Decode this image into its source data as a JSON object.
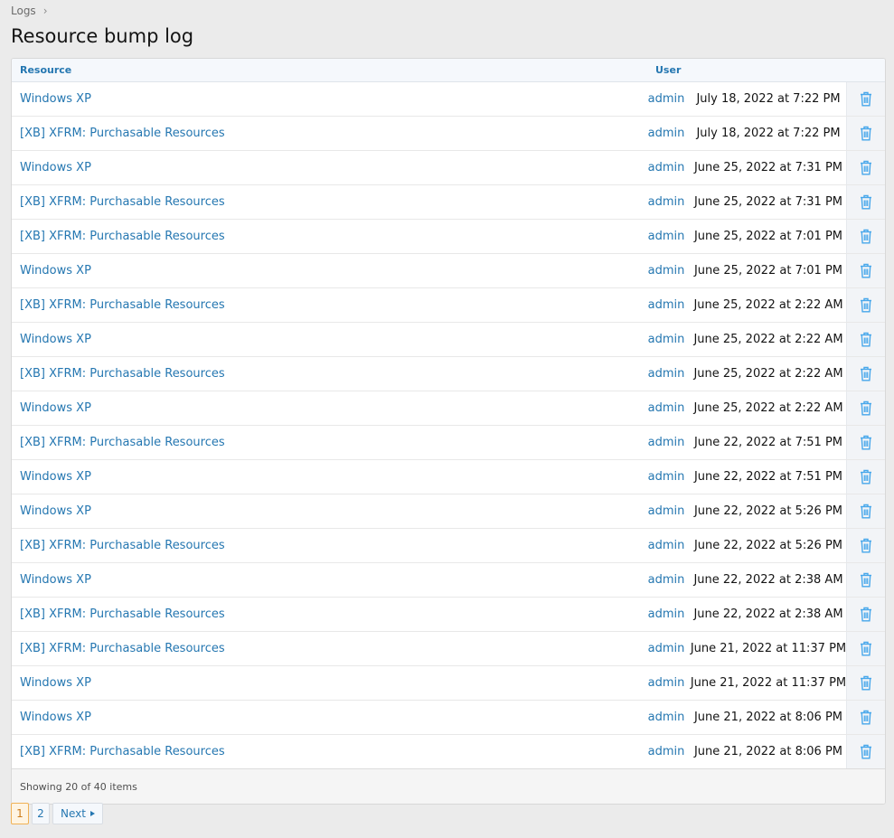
{
  "breadcrumb": {
    "label": "Logs",
    "sep": "›"
  },
  "page_title": "Resource bump log",
  "table": {
    "headers": {
      "resource": "Resource",
      "user": "User"
    },
    "rows": [
      {
        "resource": "Windows XP",
        "user": "admin",
        "date": "July 18, 2022 at 7:22 PM"
      },
      {
        "resource": "[XB] XFRM: Purchasable Resources",
        "user": "admin",
        "date": "July 18, 2022 at 7:22 PM"
      },
      {
        "resource": "Windows XP",
        "user": "admin",
        "date": "June 25, 2022 at 7:31 PM"
      },
      {
        "resource": "[XB] XFRM: Purchasable Resources",
        "user": "admin",
        "date": "June 25, 2022 at 7:31 PM"
      },
      {
        "resource": "[XB] XFRM: Purchasable Resources",
        "user": "admin",
        "date": "June 25, 2022 at 7:01 PM"
      },
      {
        "resource": "Windows XP",
        "user": "admin",
        "date": "June 25, 2022 at 7:01 PM"
      },
      {
        "resource": "[XB] XFRM: Purchasable Resources",
        "user": "admin",
        "date": "June 25, 2022 at 2:22 AM"
      },
      {
        "resource": "Windows XP",
        "user": "admin",
        "date": "June 25, 2022 at 2:22 AM"
      },
      {
        "resource": "[XB] XFRM: Purchasable Resources",
        "user": "admin",
        "date": "June 25, 2022 at 2:22 AM"
      },
      {
        "resource": "Windows XP",
        "user": "admin",
        "date": "June 25, 2022 at 2:22 AM"
      },
      {
        "resource": "[XB] XFRM: Purchasable Resources",
        "user": "admin",
        "date": "June 22, 2022 at 7:51 PM"
      },
      {
        "resource": "Windows XP",
        "user": "admin",
        "date": "June 22, 2022 at 7:51 PM"
      },
      {
        "resource": "Windows XP",
        "user": "admin",
        "date": "June 22, 2022 at 5:26 PM"
      },
      {
        "resource": "[XB] XFRM: Purchasable Resources",
        "user": "admin",
        "date": "June 22, 2022 at 5:26 PM"
      },
      {
        "resource": "Windows XP",
        "user": "admin",
        "date": "June 22, 2022 at 2:38 AM"
      },
      {
        "resource": "[XB] XFRM: Purchasable Resources",
        "user": "admin",
        "date": "June 22, 2022 at 2:38 AM"
      },
      {
        "resource": "[XB] XFRM: Purchasable Resources",
        "user": "admin",
        "date": "June 21, 2022 at 11:37 PM"
      },
      {
        "resource": "Windows XP",
        "user": "admin",
        "date": "June 21, 2022 at 11:37 PM"
      },
      {
        "resource": "Windows XP",
        "user": "admin",
        "date": "June 21, 2022 at 8:06 PM"
      },
      {
        "resource": "[XB] XFRM: Purchasable Resources",
        "user": "admin",
        "date": "June 21, 2022 at 8:06 PM"
      }
    ],
    "delete_icon": "trash-icon",
    "footer": "Showing 20 of 40 items"
  },
  "pagination": {
    "pages": [
      "1",
      "2"
    ],
    "current": "1",
    "next_label": "Next"
  },
  "colors": {
    "link": "#2577b1",
    "icon": "#47a7eb",
    "current_page": "#f0b155"
  }
}
